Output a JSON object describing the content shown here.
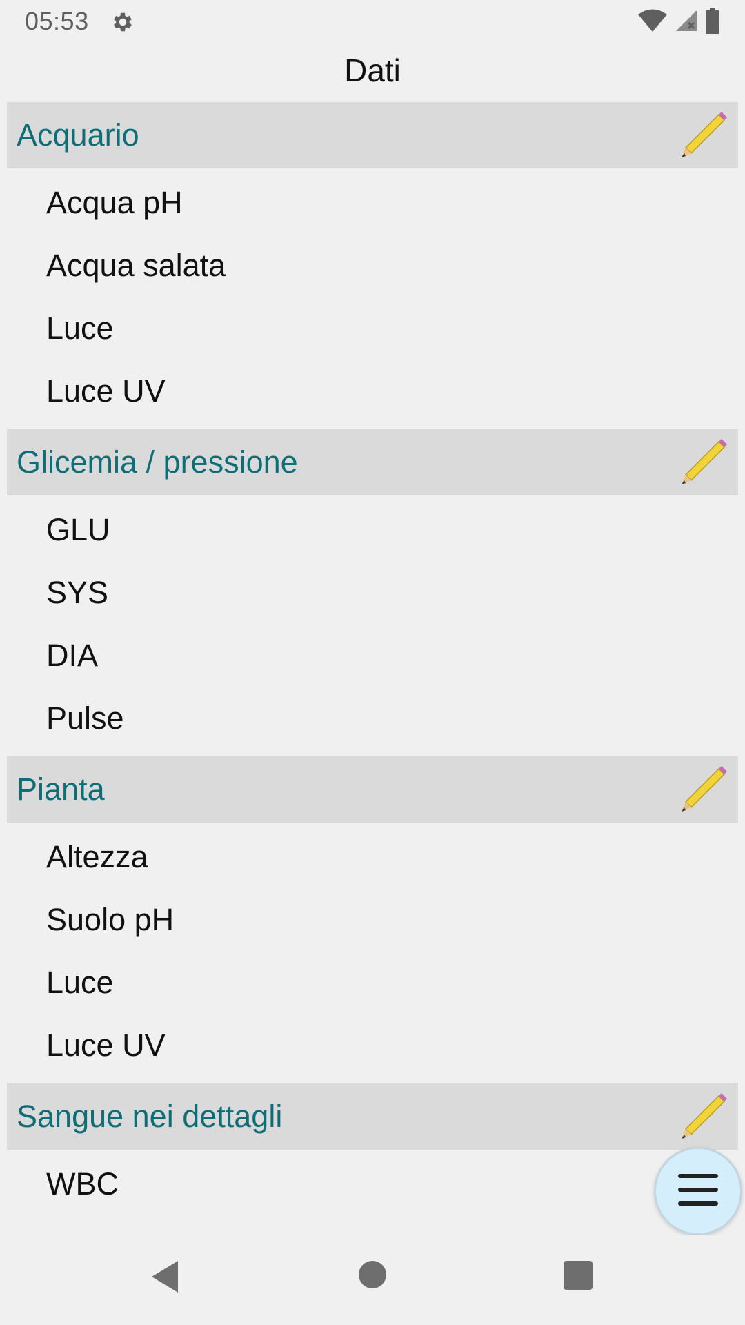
{
  "status_bar": {
    "time": "05:53",
    "left_icon": "settings-gear-icon",
    "right_icons": [
      "wifi-icon",
      "cell-signal-no-data-icon",
      "battery-icon"
    ]
  },
  "app": {
    "title": "Dati"
  },
  "groups": [
    {
      "title": "Acquario",
      "edit_icon": "pencil-icon",
      "items": [
        "Acqua pH",
        "Acqua salata",
        "Luce",
        "Luce UV"
      ]
    },
    {
      "title": "Glicemia / pressione",
      "edit_icon": "pencil-icon",
      "items": [
        "GLU",
        "SYS",
        "DIA",
        "Pulse"
      ]
    },
    {
      "title": "Pianta",
      "edit_icon": "pencil-icon",
      "items": [
        "Altezza",
        "Suolo pH",
        "Luce",
        "Luce UV"
      ]
    },
    {
      "title": "Sangue nei dettagli",
      "edit_icon": "pencil-icon",
      "items": [
        "WBC"
      ]
    }
  ],
  "fab": {
    "icon": "menu-hamburger-icon",
    "color": "#d4eefb"
  },
  "nav_bar": {
    "icons": [
      "back-triangle-icon",
      "home-circle-icon",
      "recents-square-icon"
    ]
  },
  "colors": {
    "background": "#f0f0f0",
    "header_bg": "#dadada",
    "header_text": "#0e6e78",
    "item_text": "#111111"
  }
}
